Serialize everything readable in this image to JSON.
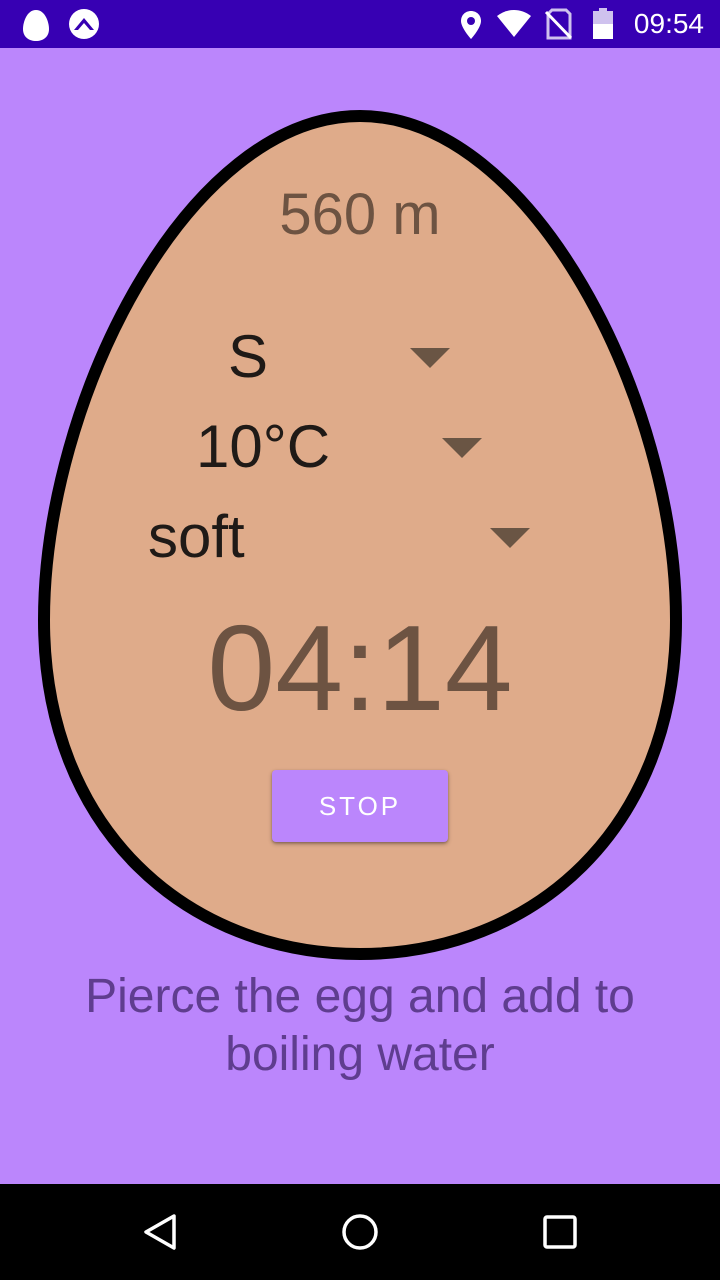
{
  "status_bar": {
    "time": "09:54",
    "icons": [
      "egg-app-icon",
      "app-notification-icon",
      "location-icon",
      "wifi-icon",
      "no-sim-icon",
      "battery-icon"
    ]
  },
  "main": {
    "altitude": "560 m",
    "dropdowns": {
      "size": {
        "value": "S"
      },
      "temperature": {
        "value": "10°C"
      },
      "consistency": {
        "value": "soft"
      }
    },
    "timer": "04:14",
    "stop_label": "STOP",
    "instruction": "Pierce the egg and add to boiling water"
  },
  "colors": {
    "background": "#bb86fc",
    "egg_fill": "#dfab8a",
    "egg_outline": "#000000",
    "status_bar": "#3700b3",
    "text_brown": "#6d5342",
    "instruction_text": "#5f3d8f"
  },
  "nav_bar": {
    "icons": [
      "back-icon",
      "home-icon",
      "recents-icon"
    ]
  }
}
